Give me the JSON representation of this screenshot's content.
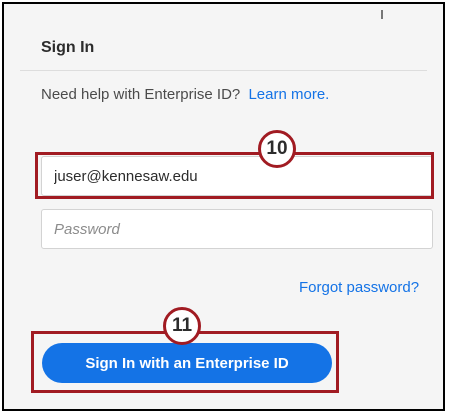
{
  "signin": {
    "title": "Sign In",
    "help_text": "Need help with Enterprise ID?",
    "help_link": "Learn more.",
    "email_value": "juser@kennesaw.edu",
    "password_placeholder": "Password",
    "forgot_link": "Forgot password?",
    "button_label": "Sign In with an Enterprise ID"
  },
  "callouts": {
    "step_email": "10",
    "step_button": "11"
  },
  "colors": {
    "accent": "#1473e6",
    "callout": "#a11b22"
  }
}
